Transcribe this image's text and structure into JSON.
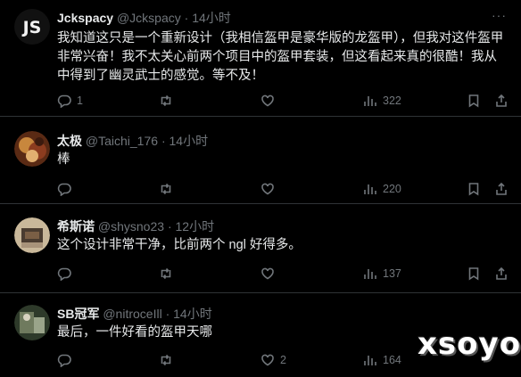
{
  "tweets": [
    {
      "name": "Jckspacy",
      "handle": "@Jckspacy",
      "sep": "·",
      "time": "14小时",
      "text": "我知道这只是一个重新设计（我相信盔甲是豪华版的龙盔甲），但我对这件盔甲非常兴奋！我不太关心前两个项目中的盔甲套装，但这看起来真的很酷！我从中得到了幽灵武士的感觉。等不及！",
      "avatar_text": "JS",
      "replies": "1",
      "retweets": "",
      "likes": "",
      "views": "322"
    },
    {
      "name": "太极",
      "handle": "@Taichi_176",
      "sep": "·",
      "time": "14小时",
      "text": "棒",
      "replies": "",
      "retweets": "",
      "likes": "",
      "views": "220"
    },
    {
      "name": "希斯诺",
      "handle": "@shysno23",
      "sep": "·",
      "time": "12小时",
      "text": "这个设计非常干净，比前两个 ngl 好得多。",
      "replies": "",
      "retweets": "",
      "likes": "",
      "views": "137"
    },
    {
      "name": "SB冠军",
      "handle": "@nitroceIll",
      "sep": "·",
      "time": "14小时",
      "text": "最后，一件好看的盔甲天哪",
      "replies": "",
      "retweets": "",
      "likes": "2",
      "views": "164"
    }
  ],
  "more_label": "···",
  "watermark": "xsoyo",
  "colors": {
    "background": "#000000",
    "text": "#e7e9ea",
    "muted": "#71767b",
    "divider": "#2f3336"
  },
  "icons": [
    "reply-icon",
    "retweet-icon",
    "like-icon",
    "views-icon",
    "bookmark-icon",
    "share-icon",
    "more-icon"
  ]
}
